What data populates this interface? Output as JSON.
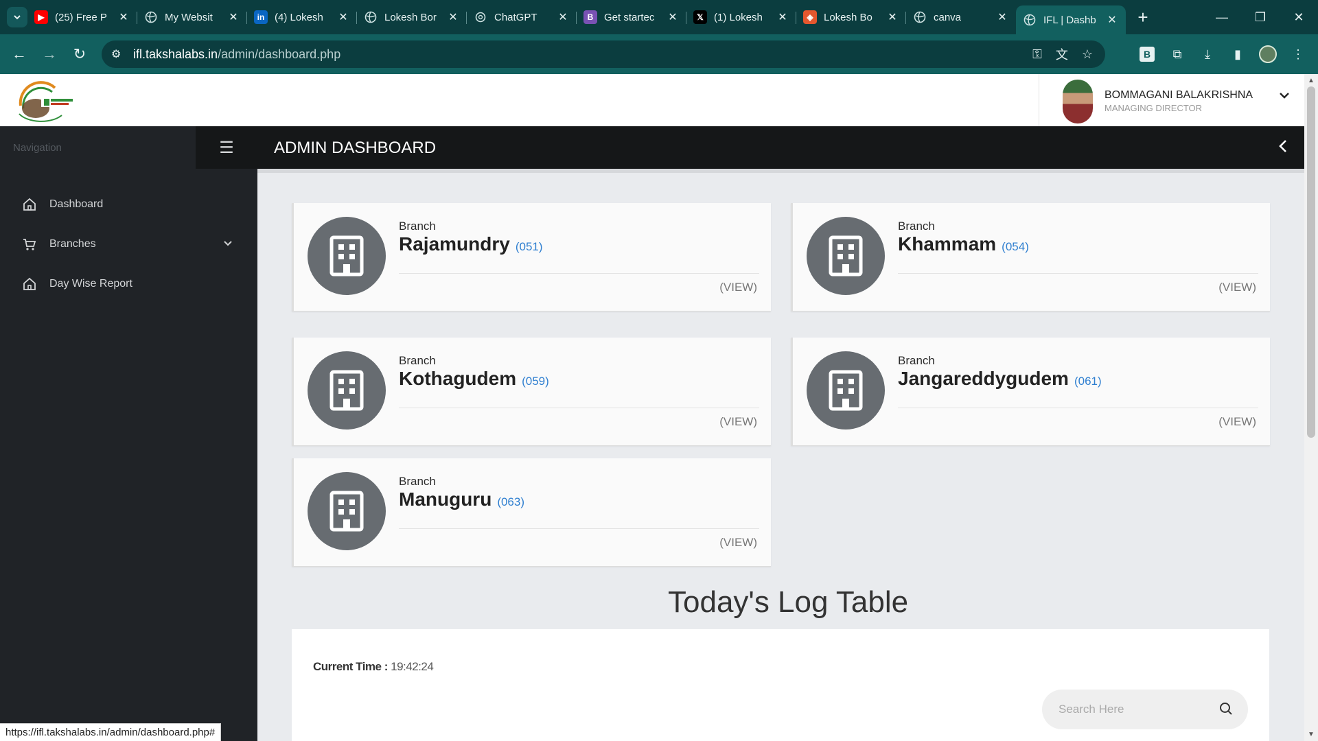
{
  "browser": {
    "tabs": [
      {
        "title": "(25) Free P",
        "icon": "youtube-icon",
        "icon_color": "#ff0000"
      },
      {
        "title": "My Websit",
        "icon": "globe-icon",
        "icon_color": "#cfe3e3"
      },
      {
        "title": "(4) Lokesh",
        "icon": "linkedin-icon",
        "icon_color": "#0a66c2"
      },
      {
        "title": "Lokesh Bor",
        "icon": "globe-icon",
        "icon_color": "#cfe3e3"
      },
      {
        "title": "ChatGPT",
        "icon": "chatgpt-icon",
        "icon_color": "#cfe3e3"
      },
      {
        "title": "Get startec",
        "icon": "bootstrap-icon",
        "icon_color": "#7952b3"
      },
      {
        "title": "(1) Lokesh",
        "icon": "x-icon",
        "icon_color": "#000000"
      },
      {
        "title": "Lokesh Bo",
        "icon": "codepen-icon",
        "icon_color": "#e4572e"
      },
      {
        "title": "canva",
        "icon": "globe-icon",
        "icon_color": "#cfe3e3"
      },
      {
        "title": "IFL | Dashb",
        "icon": "globe-icon",
        "icon_color": "#cfe3e3",
        "active": true
      }
    ],
    "url_host": "ifl.takshalabs.in",
    "url_path": "/admin/dashboard.php",
    "status_url": "https://ifl.takshalabs.in/admin/dashboard.php#"
  },
  "user": {
    "name": "BOMMAGANI BALAKRISHNA",
    "role": "MANAGING DIRECTOR"
  },
  "sidebar": {
    "heading": "Navigation",
    "items": [
      {
        "label": "Dashboard",
        "icon": "home-icon"
      },
      {
        "label": "Branches",
        "icon": "cart-icon",
        "has_dropdown": true
      },
      {
        "label": "Day Wise Report",
        "icon": "home-icon"
      }
    ]
  },
  "header": {
    "title": "ADMIN DASHBOARD"
  },
  "branches": [
    {
      "label": "Branch",
      "name": "Rajamundry",
      "code": "(051)",
      "action": "(VIEW)"
    },
    {
      "label": "Branch",
      "name": "Khammam",
      "code": "(054)",
      "action": "(VIEW)"
    },
    {
      "label": "Branch",
      "name": "Kothagudem",
      "code": "(059)",
      "action": "(VIEW)"
    },
    {
      "label": "Branch",
      "name": "Jangareddygudem",
      "code": "(061)",
      "action": "(VIEW)"
    },
    {
      "label": "Branch",
      "name": "Manuguru",
      "code": "(063)",
      "action": "(VIEW)"
    }
  ],
  "log": {
    "title": "Today's Log Table",
    "time_label": "Current Time :",
    "time_value": "19:42:24",
    "search_placeholder": "Search Here"
  },
  "colors": {
    "browser_frame": "#0b3d3f",
    "browser_toolbar": "#12605f",
    "sidebar": "#202327",
    "header": "#151718",
    "branch_icon_bg": "#676c71",
    "code_link": "#2f7fd0"
  }
}
